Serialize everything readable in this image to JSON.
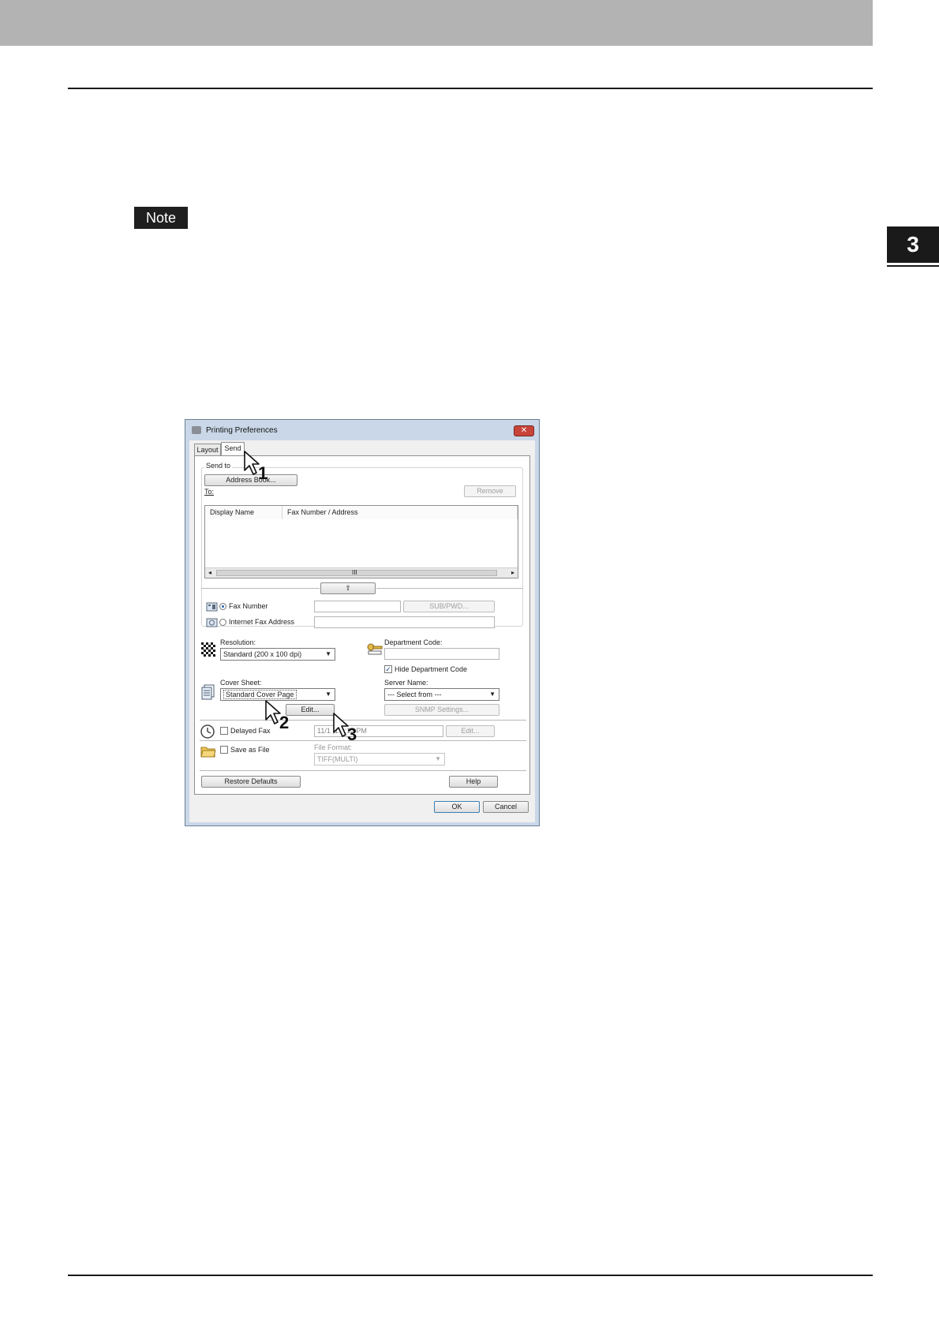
{
  "page": {
    "note_label": "Note",
    "chapter_number": "3"
  },
  "dialog": {
    "title": "Printing Preferences",
    "close_glyph": "✕",
    "tabs": [
      {
        "label": "Layout",
        "active": false
      },
      {
        "label": "Send",
        "active": true
      }
    ],
    "send_to": {
      "group_label": "Send to",
      "address_book_button": "Address Book...",
      "to_label": "To:",
      "remove_button": "Remove",
      "columns": [
        "Display Name",
        "Fax Number / Address"
      ],
      "scroll_grip": "III",
      "move_up_glyph": "⇧",
      "fax_number_label": "Fax Number",
      "internet_fax_label": "Internet Fax Address",
      "sub_pwd_button": "SUB/PWD..."
    },
    "resolution": {
      "label": "Resolution:",
      "value": "Standard (200 x 100 dpi)"
    },
    "department": {
      "label": "Department Code:",
      "hide_label": "Hide Department Code",
      "hide_checked": true
    },
    "cover_sheet": {
      "label": "Cover Sheet:",
      "value": "Standard Cover Page",
      "edit_button": "Edit..."
    },
    "server": {
      "label": "Server Name:",
      "value": "--- Select from ---",
      "snmp_button": "SNMP Settings..."
    },
    "delayed_fax": {
      "label": "Delayed Fax",
      "value": "11/1   ,1:6:12 PM",
      "edit_button": "Edit..."
    },
    "save_as_file": {
      "label": "Save as File",
      "file_format_label": "File Format:",
      "file_format_value": "TIFF(MULTI)"
    },
    "restore_defaults_button": "Restore Defaults",
    "help_button": "Help",
    "ok_button": "OK",
    "cancel_button": "Cancel"
  },
  "callouts": [
    "1",
    "2",
    "3"
  ]
}
